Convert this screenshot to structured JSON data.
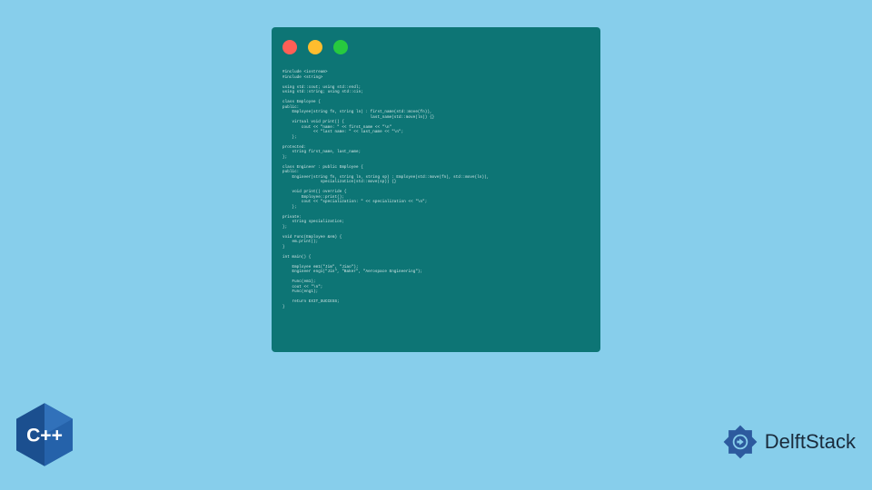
{
  "code": {
    "lines": [
      "#include <iostream>",
      "#include <string>",
      "",
      "using std::cout; using std::endl;",
      "using std::string; using std::cin;",
      "",
      "class Employee {",
      "public:",
      "    Employee(string fn, string ln) : first_name(std::move(fn)),",
      "                                     last_name(std::move(ln)) {}",
      "    virtual void print() {",
      "        cout << \"name: \" << first_name << \"\\n\"",
      "             << \"last name: \" << last_name << \"\\n\";",
      "    };",
      "",
      "protected:",
      "    string first_name, last_name;",
      "};",
      "",
      "class Engineer : public Employee {",
      "public:",
      "    Engineer(string fn, string ln, string sp) : Employee(std::move(fn), std::move(ln)),",
      "                specialization(std::move(sp)) {}",
      "",
      "    void print() override {",
      "        Employee::print();",
      "        cout << \"specialization: \" << specialization << \"\\n\";",
      "    };",
      "",
      "private:",
      "    string specialization;",
      "};",
      "",
      "void Func(Employee &em) {",
      "    em.print();",
      "}",
      "",
      "int main() {",
      "",
      "    Employee em1(\"Jim\", \"Jiao\");",
      "    Engineer eng1(\"Jin\", \"Baker\", \"Aerospace Engineering\");",
      "",
      "    Func(em1);",
      "    cout << \"\\n\";",
      "    Func(eng1);",
      "",
      "    return EXIT_SUCCESS;",
      "}"
    ]
  },
  "logos": {
    "cpp_label": "C++",
    "delft_label": "DelftStack"
  },
  "colors": {
    "background": "#87ceeb",
    "window": "#0d7575",
    "red": "#ff5f56",
    "yellow": "#ffbd2e",
    "green": "#27c93f",
    "cpp_blue": "#1b4f8f",
    "delft_blue": "#2d5a9e"
  }
}
